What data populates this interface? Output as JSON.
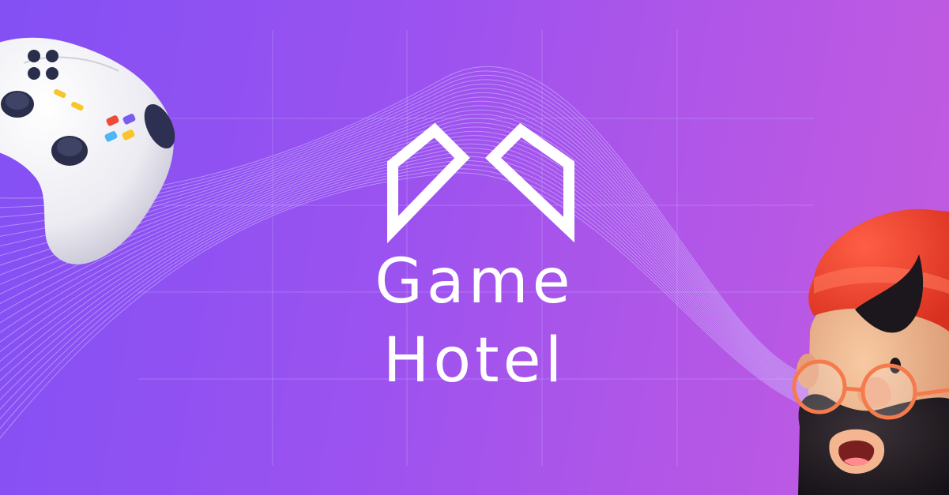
{
  "brand": {
    "name_line1": "Game",
    "name_line2": "Hotel",
    "logo_icon": "game-hotel-logo-icon",
    "text_color": "#ffffff"
  },
  "background": {
    "gradient_start": "#8350f4",
    "gradient_end": "#c35ce0",
    "grid_color": "#c8b4ff",
    "wave_color": "#d2c3ff"
  },
  "illustrations": {
    "left": "game-controller-icon",
    "right": "bearded-character-icon"
  }
}
